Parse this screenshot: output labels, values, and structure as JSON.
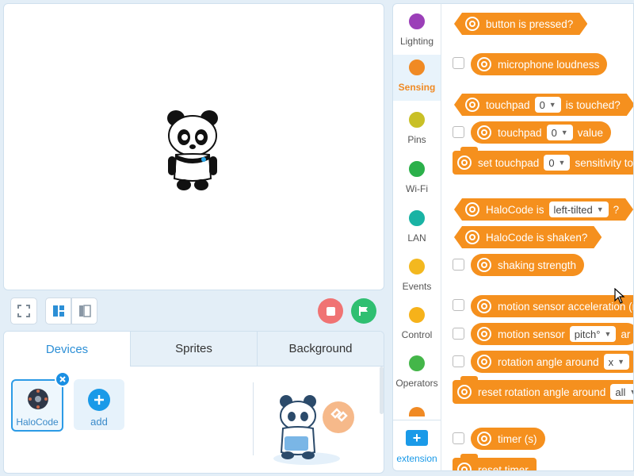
{
  "stage": {},
  "toolbar": {},
  "bottom_tabs": [
    {
      "label": "Devices",
      "active": true
    },
    {
      "label": "Sprites",
      "active": false
    },
    {
      "label": "Background",
      "active": false
    }
  ],
  "devices": {
    "items": [
      {
        "label": "HaloCode"
      }
    ],
    "add_label": "add"
  },
  "categories": [
    {
      "label": "Lighting",
      "color": "#9b3fb8",
      "icon": "sensor-icon"
    },
    {
      "label": "Sensing",
      "color": "#f08a24",
      "icon": "sensor-icon",
      "active": true
    },
    {
      "label": "Pins",
      "color": "#c9c026",
      "icon": "sensor-icon"
    },
    {
      "label": "Wi-Fi",
      "color": "#2bb04a",
      "icon": "sensor-icon"
    },
    {
      "label": "LAN",
      "color": "#19b3a4",
      "icon": "sensor-icon"
    },
    {
      "label": "Events",
      "color": "#f3b81f",
      "icon": "dot-icon"
    },
    {
      "label": "Control",
      "color": "#f6b21a",
      "icon": "dot-icon"
    },
    {
      "label": "Operators",
      "color": "#44b649",
      "icon": "dot-icon"
    }
  ],
  "extension_label": "extension",
  "blocks": {
    "button_pressed": "button is pressed?",
    "mic_loudness": "microphone loudness",
    "touchpad_touched_a": "touchpad",
    "touchpad_touched_val": "0",
    "touchpad_touched_b": "is touched?",
    "touchpad_value_a": "touchpad",
    "touchpad_value_val": "0",
    "touchpad_value_b": "value",
    "set_touchpad_a": "set touchpad",
    "set_touchpad_val": "0",
    "set_touchpad_b": "sensitivity to",
    "halocode_is_a": "HaloCode is",
    "halocode_is_val": "left-tilted",
    "halocode_is_b": "?",
    "halocode_shaken": "HaloCode is shaken?",
    "shaking_strength": "shaking strength",
    "motion_accel": "motion sensor acceleration (m",
    "motion_sensor_a": "motion sensor",
    "motion_sensor_val": "pitch°",
    "motion_sensor_b": "ar",
    "rotation_angle_a": "rotation angle around",
    "rotation_angle_val": "x",
    "reset_rotation_a": "reset rotation angle around",
    "reset_rotation_val": "all",
    "timer": "timer (s)",
    "reset_timer": "reset timer"
  }
}
